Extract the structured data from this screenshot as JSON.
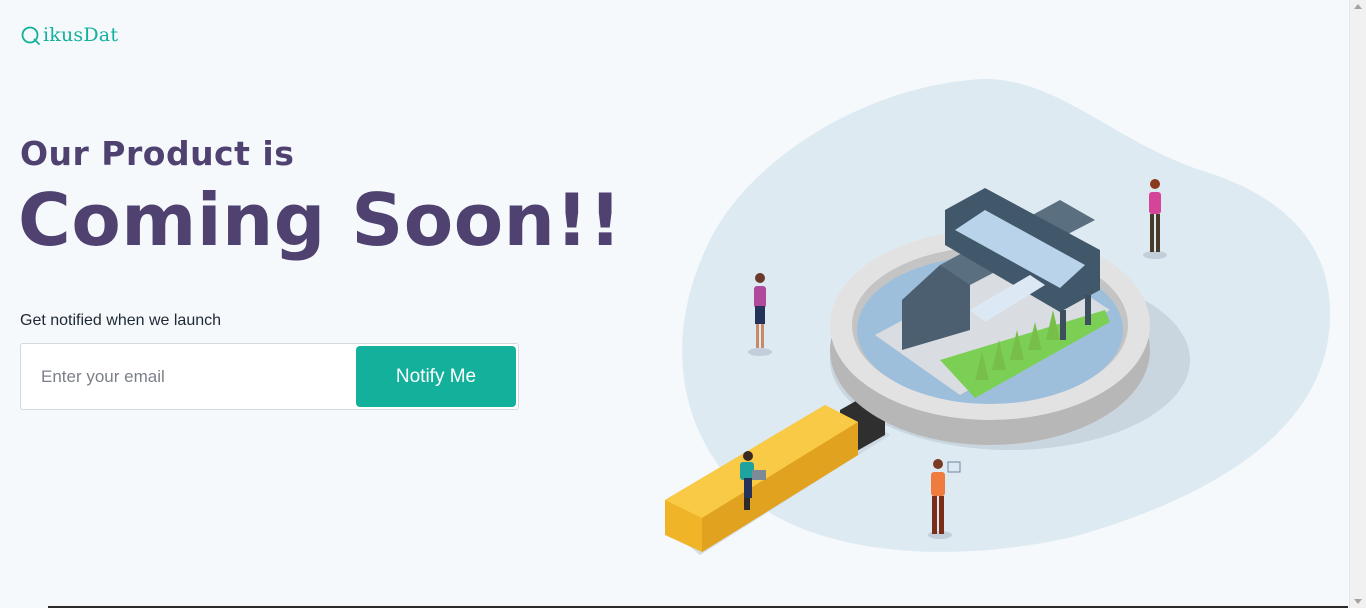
{
  "brand": {
    "name": "QikusDat",
    "name_rest": "ikusDat",
    "color": "#13b09b"
  },
  "hero": {
    "subtitle": "Our Product is",
    "title": "Coming Soon!!",
    "text_color": "#4f4170"
  },
  "signup": {
    "label": "Get notified when we launch",
    "email_placeholder": "Enter your email",
    "email_value": "",
    "button_label": "Notify Me",
    "button_color": "#13b09b"
  },
  "illustration": {
    "icon": "magnifying-glass-city-illustration",
    "blob_color": "#deeaf2",
    "handle_color": "#f7c033"
  }
}
